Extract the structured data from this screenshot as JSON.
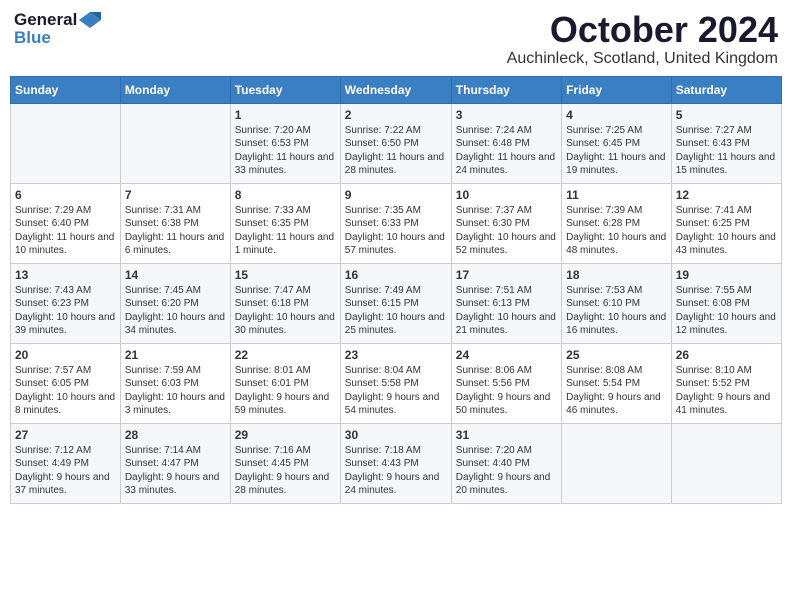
{
  "logo": {
    "general": "General",
    "blue": "Blue"
  },
  "header": {
    "title": "October 2024",
    "location": "Auchinleck, Scotland, United Kingdom"
  },
  "weekdays": [
    "Sunday",
    "Monday",
    "Tuesday",
    "Wednesday",
    "Thursday",
    "Friday",
    "Saturday"
  ],
  "weeks": [
    [
      null,
      null,
      {
        "day": "1",
        "sunrise": "Sunrise: 7:20 AM",
        "sunset": "Sunset: 6:53 PM",
        "daylight": "Daylight: 11 hours and 33 minutes."
      },
      {
        "day": "2",
        "sunrise": "Sunrise: 7:22 AM",
        "sunset": "Sunset: 6:50 PM",
        "daylight": "Daylight: 11 hours and 28 minutes."
      },
      {
        "day": "3",
        "sunrise": "Sunrise: 7:24 AM",
        "sunset": "Sunset: 6:48 PM",
        "daylight": "Daylight: 11 hours and 24 minutes."
      },
      {
        "day": "4",
        "sunrise": "Sunrise: 7:25 AM",
        "sunset": "Sunset: 6:45 PM",
        "daylight": "Daylight: 11 hours and 19 minutes."
      },
      {
        "day": "5",
        "sunrise": "Sunrise: 7:27 AM",
        "sunset": "Sunset: 6:43 PM",
        "daylight": "Daylight: 11 hours and 15 minutes."
      }
    ],
    [
      {
        "day": "6",
        "sunrise": "Sunrise: 7:29 AM",
        "sunset": "Sunset: 6:40 PM",
        "daylight": "Daylight: 11 hours and 10 minutes."
      },
      {
        "day": "7",
        "sunrise": "Sunrise: 7:31 AM",
        "sunset": "Sunset: 6:38 PM",
        "daylight": "Daylight: 11 hours and 6 minutes."
      },
      {
        "day": "8",
        "sunrise": "Sunrise: 7:33 AM",
        "sunset": "Sunset: 6:35 PM",
        "daylight": "Daylight: 11 hours and 1 minute."
      },
      {
        "day": "9",
        "sunrise": "Sunrise: 7:35 AM",
        "sunset": "Sunset: 6:33 PM",
        "daylight": "Daylight: 10 hours and 57 minutes."
      },
      {
        "day": "10",
        "sunrise": "Sunrise: 7:37 AM",
        "sunset": "Sunset: 6:30 PM",
        "daylight": "Daylight: 10 hours and 52 minutes."
      },
      {
        "day": "11",
        "sunrise": "Sunrise: 7:39 AM",
        "sunset": "Sunset: 6:28 PM",
        "daylight": "Daylight: 10 hours and 48 minutes."
      },
      {
        "day": "12",
        "sunrise": "Sunrise: 7:41 AM",
        "sunset": "Sunset: 6:25 PM",
        "daylight": "Daylight: 10 hours and 43 minutes."
      }
    ],
    [
      {
        "day": "13",
        "sunrise": "Sunrise: 7:43 AM",
        "sunset": "Sunset: 6:23 PM",
        "daylight": "Daylight: 10 hours and 39 minutes."
      },
      {
        "day": "14",
        "sunrise": "Sunrise: 7:45 AM",
        "sunset": "Sunset: 6:20 PM",
        "daylight": "Daylight: 10 hours and 34 minutes."
      },
      {
        "day": "15",
        "sunrise": "Sunrise: 7:47 AM",
        "sunset": "Sunset: 6:18 PM",
        "daylight": "Daylight: 10 hours and 30 minutes."
      },
      {
        "day": "16",
        "sunrise": "Sunrise: 7:49 AM",
        "sunset": "Sunset: 6:15 PM",
        "daylight": "Daylight: 10 hours and 25 minutes."
      },
      {
        "day": "17",
        "sunrise": "Sunrise: 7:51 AM",
        "sunset": "Sunset: 6:13 PM",
        "daylight": "Daylight: 10 hours and 21 minutes."
      },
      {
        "day": "18",
        "sunrise": "Sunrise: 7:53 AM",
        "sunset": "Sunset: 6:10 PM",
        "daylight": "Daylight: 10 hours and 16 minutes."
      },
      {
        "day": "19",
        "sunrise": "Sunrise: 7:55 AM",
        "sunset": "Sunset: 6:08 PM",
        "daylight": "Daylight: 10 hours and 12 minutes."
      }
    ],
    [
      {
        "day": "20",
        "sunrise": "Sunrise: 7:57 AM",
        "sunset": "Sunset: 6:05 PM",
        "daylight": "Daylight: 10 hours and 8 minutes."
      },
      {
        "day": "21",
        "sunrise": "Sunrise: 7:59 AM",
        "sunset": "Sunset: 6:03 PM",
        "daylight": "Daylight: 10 hours and 3 minutes."
      },
      {
        "day": "22",
        "sunrise": "Sunrise: 8:01 AM",
        "sunset": "Sunset: 6:01 PM",
        "daylight": "Daylight: 9 hours and 59 minutes."
      },
      {
        "day": "23",
        "sunrise": "Sunrise: 8:04 AM",
        "sunset": "Sunset: 5:58 PM",
        "daylight": "Daylight: 9 hours and 54 minutes."
      },
      {
        "day": "24",
        "sunrise": "Sunrise: 8:06 AM",
        "sunset": "Sunset: 5:56 PM",
        "daylight": "Daylight: 9 hours and 50 minutes."
      },
      {
        "day": "25",
        "sunrise": "Sunrise: 8:08 AM",
        "sunset": "Sunset: 5:54 PM",
        "daylight": "Daylight: 9 hours and 46 minutes."
      },
      {
        "day": "26",
        "sunrise": "Sunrise: 8:10 AM",
        "sunset": "Sunset: 5:52 PM",
        "daylight": "Daylight: 9 hours and 41 minutes."
      }
    ],
    [
      {
        "day": "27",
        "sunrise": "Sunrise: 7:12 AM",
        "sunset": "Sunset: 4:49 PM",
        "daylight": "Daylight: 9 hours and 37 minutes."
      },
      {
        "day": "28",
        "sunrise": "Sunrise: 7:14 AM",
        "sunset": "Sunset: 4:47 PM",
        "daylight": "Daylight: 9 hours and 33 minutes."
      },
      {
        "day": "29",
        "sunrise": "Sunrise: 7:16 AM",
        "sunset": "Sunset: 4:45 PM",
        "daylight": "Daylight: 9 hours and 28 minutes."
      },
      {
        "day": "30",
        "sunrise": "Sunrise: 7:18 AM",
        "sunset": "Sunset: 4:43 PM",
        "daylight": "Daylight: 9 hours and 24 minutes."
      },
      {
        "day": "31",
        "sunrise": "Sunrise: 7:20 AM",
        "sunset": "Sunset: 4:40 PM",
        "daylight": "Daylight: 9 hours and 20 minutes."
      },
      null,
      null
    ]
  ]
}
